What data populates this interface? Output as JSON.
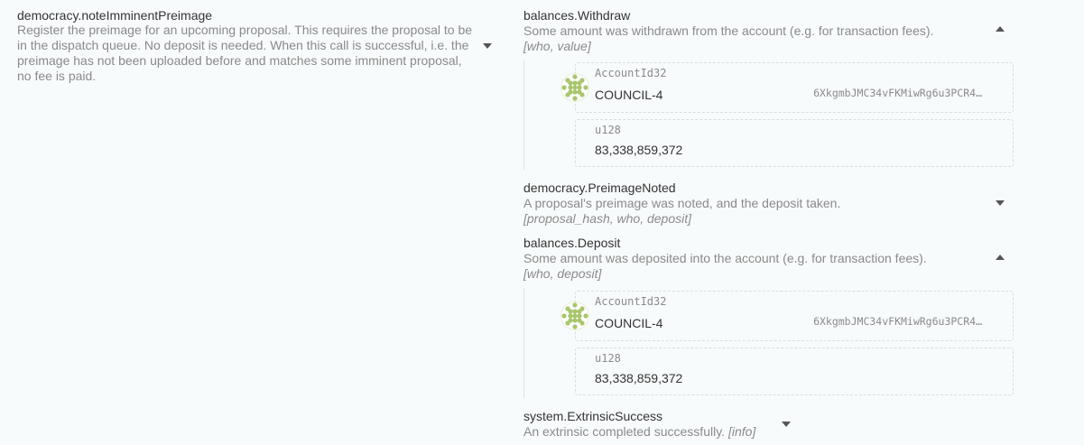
{
  "call": {
    "title": "democracy.noteImminentPreimage",
    "description": "Register the preimage for an upcoming proposal. This requires the proposal to be in the dispatch queue. No deposit is needed. When this call is successful, i.e. the preimage has not been uploaded before and matches some imminent proposal, no fee is paid."
  },
  "events": [
    {
      "title": "balances.Withdraw",
      "description": "Some amount was withdrawn from the account (e.g. for transaction fees).",
      "params": "[who, value]",
      "expanded": true,
      "fields": [
        {
          "type": "AccountId32",
          "value": "COUNCIL-4",
          "address": "6XkgmbJMC34vFKMiwRg6u3PCR4…",
          "icon": "polkadot-identicon"
        },
        {
          "type": "u128",
          "value": "83,338,859,372"
        }
      ]
    },
    {
      "title": "democracy.PreimageNoted",
      "description": "A proposal's preimage was noted, and the deposit taken.",
      "params": "[proposal_hash, who, deposit]",
      "expanded": false
    },
    {
      "title": "balances.Deposit",
      "description": "Some amount was deposited into the account (e.g. for transaction fees).",
      "params": "[who, deposit]",
      "expanded": true,
      "fields": [
        {
          "type": "AccountId32",
          "value": "COUNCIL-4",
          "address": "6XkgmbJMC34vFKMiwRg6u3PCR4…",
          "icon": "polkadot-identicon"
        },
        {
          "type": "u128",
          "value": "83,338,859,372"
        }
      ]
    },
    {
      "title": "system.ExtrinsicSuccess",
      "description": "An extrinsic completed successfully.",
      "params": "[info]",
      "expanded": false
    }
  ],
  "colors": {
    "background": "#f8fbfc",
    "identicon": "#a8c66c"
  }
}
